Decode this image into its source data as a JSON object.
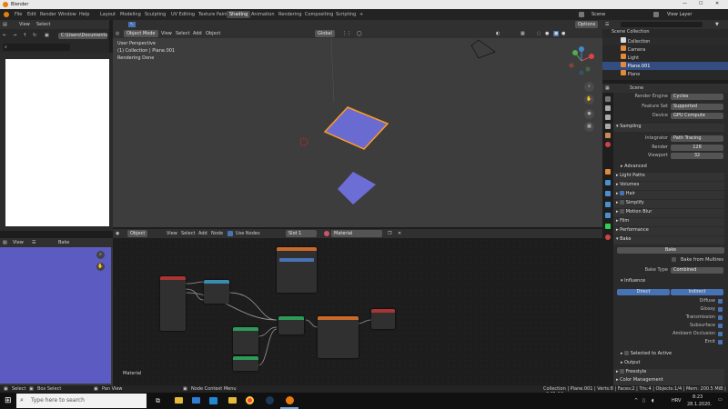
{
  "window": {
    "title": "Blender"
  },
  "menu": {
    "items": [
      "File",
      "Edit",
      "Render",
      "Window",
      "Help"
    ]
  },
  "workspaces": [
    "Layout",
    "Modeling",
    "Sculpting",
    "UV Editing",
    "Texture Paint",
    "Shading",
    "Animation",
    "Rendering",
    "Compositing",
    "Scripting",
    "+"
  ],
  "topright": {
    "scene": "Scene",
    "view_layer": "View Layer"
  },
  "filebrowser": {
    "view": "View",
    "select": "Select",
    "path": "C:\\Users\\Documents\\"
  },
  "viewport": {
    "mode": "Object Mode",
    "view": "View",
    "select": "Select",
    "add": "Add",
    "object": "Object",
    "global": "Global",
    "options": "Options",
    "info1": "User Perspective",
    "info2": "(1) Collection | Plane.001",
    "info3": "Rendering Done"
  },
  "image_editor": {
    "view": "View",
    "name": "Bake",
    "label": "Material"
  },
  "node_editor": {
    "object": "Object",
    "view": "View",
    "select": "Select",
    "add": "Add",
    "node": "Node",
    "use_nodes": "Use Nodes",
    "slot": "Slot 1",
    "material": "Material"
  },
  "outliner": {
    "title": "Scene Collection",
    "items": [
      {
        "label": "Collection",
        "color": "#cfcfcf"
      },
      {
        "label": "Camera",
        "color": "#cfcfcf"
      },
      {
        "label": "Light",
        "color": "#cfcfcf"
      },
      {
        "label": "Plane.001",
        "color": "#ffffff"
      },
      {
        "label": "Plane",
        "color": "#cfcfcf"
      }
    ]
  },
  "properties": {
    "scene": "Scene",
    "render_engine_lbl": "Render Engine",
    "render_engine": "Cycles",
    "feature_set_lbl": "Feature Set",
    "feature_set": "Supported",
    "device_lbl": "Device",
    "device": "GPU Compute",
    "sampling": "Sampling",
    "integrator_lbl": "Integrator",
    "integrator": "Path Tracing",
    "render_lbl": "Render",
    "render_val": "128",
    "viewport_lbl": "Viewport",
    "viewport_val": "32",
    "advanced": "Advanced",
    "light_paths": "Light Paths",
    "volumes": "Volumes",
    "hair": "Hair",
    "simplify": "Simplify",
    "motion_blur": "Motion Blur",
    "film": "Film",
    "performance": "Performance",
    "bake": "Bake",
    "bake_btn": "Bake",
    "bake_from_multires": "Bake from Multires",
    "bake_type_lbl": "Bake Type",
    "bake_type": "Combined",
    "influence": "Influence",
    "direct": "Direct",
    "indirect": "Indirect",
    "diffuse": "Diffuse",
    "glossy": "Glossy",
    "transmission": "Transmission",
    "subsurface": "Subsurface",
    "ambient_occlusion": "Ambient Occlusion",
    "emit": "Emit",
    "selected_to_active": "Selected to Active",
    "output": "Output",
    "freestyle": "Freestyle",
    "color_management": "Color Management"
  },
  "statusbar": {
    "select": "Select",
    "box_select": "Box Select",
    "pan_view": "Pan View",
    "node_context": "Node Context Menu",
    "stats": "Collection | Plane.001 | Verts:8 | Faces:2 | Tris:4 | Objects:1/4 | Mem: 200.5 MiB | v2.81.16"
  },
  "taskbar": {
    "search": "Type here to search",
    "lang": "HRV",
    "time": "8:23",
    "date": "28.1.2020."
  },
  "colors": {
    "accent": "#4772b3",
    "selection": "#ff9c22",
    "active_tab": "#4b4b4b"
  }
}
